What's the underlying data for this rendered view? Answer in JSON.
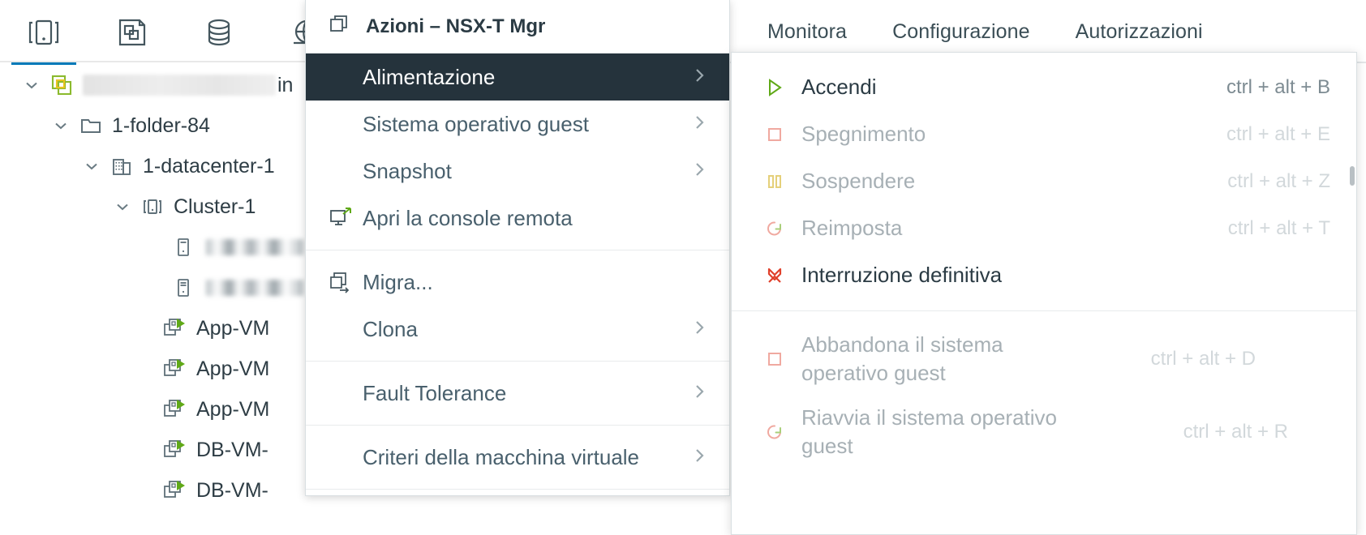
{
  "colors": {
    "accent": "#0079b8",
    "menu_highlight_bg": "#25333c",
    "text": "#2b3b44",
    "muted_text": "#7d8b92",
    "disabled_text": "#a7b0b5",
    "green": "#60a917",
    "red": "#e1604e",
    "yellow": "#d9b300",
    "border": "#e8ebec"
  },
  "icon_bar": {
    "tabs": [
      {
        "name": "hosts-and-clusters-icon",
        "label": "Host e cluster",
        "active": true
      },
      {
        "name": "vms-and-templates-icon",
        "label": "VM e modelli",
        "active": false
      },
      {
        "name": "storage-icon",
        "label": "Storage",
        "active": false
      },
      {
        "name": "networking-icon",
        "label": "Rete",
        "active": false
      }
    ]
  },
  "nav_tabs": [
    {
      "label": "Monitora"
    },
    {
      "label": "Configurazione"
    },
    {
      "label": "Autorizzazioni"
    }
  ],
  "tree": {
    "rows": [
      {
        "indent": 0,
        "twisty": "chevron-down",
        "icon": "vcenter-icon",
        "label": "",
        "redacted": true,
        "redacted_width": 250,
        "suffix": "in"
      },
      {
        "indent": 1,
        "twisty": "chevron-down",
        "icon": "folder-icon",
        "label": "1-folder-84",
        "redacted": false
      },
      {
        "indent": 2,
        "twisty": "chevron-down",
        "icon": "datacenter-icon",
        "label": "1-datacenter-1",
        "redacted": false
      },
      {
        "indent": 3,
        "twisty": "chevron-down",
        "icon": "cluster-icon",
        "label": "Cluster-1",
        "redacted": false
      },
      {
        "indent": 4,
        "twisty": "",
        "icon": "host-icon",
        "label": "",
        "redacted": true,
        "redacted_width": 130
      },
      {
        "indent": 4,
        "twisty": "",
        "icon": "host-icon",
        "label": "",
        "redacted": true,
        "redacted_width": 130
      },
      {
        "indent": 4,
        "twisty": "",
        "icon": "vm-running-icon",
        "label": "App-VM",
        "redacted": false
      },
      {
        "indent": 4,
        "twisty": "",
        "icon": "vm-running-icon",
        "label": "App-VM",
        "redacted": false
      },
      {
        "indent": 4,
        "twisty": "",
        "icon": "vm-running-icon",
        "label": "App-VM",
        "redacted": false
      },
      {
        "indent": 4,
        "twisty": "",
        "icon": "vm-running-icon",
        "label": "DB-VM-",
        "redacted": false
      },
      {
        "indent": 4,
        "twisty": "",
        "icon": "vm-running-icon",
        "label": "DB-VM-",
        "redacted": false
      }
    ]
  },
  "menu": {
    "header": {
      "title": "Azioni – NSX-T Mgr",
      "icon": "vm-actions-icon"
    },
    "items": [
      {
        "label": "Alimentazione",
        "icon": "",
        "arrow": true,
        "selected": true
      },
      {
        "label": "Sistema operativo guest",
        "icon": "",
        "arrow": true,
        "selected": false
      },
      {
        "label": "Snapshot",
        "icon": "",
        "arrow": true,
        "selected": false
      },
      {
        "label": "Apri la console remota",
        "icon": "remote-console-icon",
        "arrow": false,
        "selected": false
      },
      {
        "separator": true
      },
      {
        "label": "Migra...",
        "icon": "migrate-icon",
        "arrow": false,
        "selected": false
      },
      {
        "label": "Clona",
        "icon": "",
        "arrow": true,
        "selected": false
      },
      {
        "separator": true
      },
      {
        "label": "Fault Tolerance",
        "icon": "",
        "arrow": true,
        "selected": false
      },
      {
        "separator": true
      },
      {
        "label": "Criteri della macchina virtuale",
        "icon": "",
        "arrow": true,
        "selected": false
      }
    ]
  },
  "submenu": {
    "items": [
      {
        "label": "Accendi",
        "shortcut": "ctrl + alt + B",
        "icon": "power-on-icon",
        "disabled": false,
        "two_line": false
      },
      {
        "label": "Spegnimento",
        "shortcut": "ctrl + alt + E",
        "icon": "power-off-icon",
        "disabled": true,
        "two_line": false
      },
      {
        "label": "Sospendere",
        "shortcut": "ctrl + alt + Z",
        "icon": "suspend-icon",
        "disabled": true,
        "two_line": false
      },
      {
        "label": "Reimposta",
        "shortcut": "ctrl + alt + T",
        "icon": "reset-icon",
        "disabled": true,
        "two_line": false
      },
      {
        "label": "Interruzione definitiva",
        "shortcut": "",
        "icon": "shutdown-hard-icon",
        "disabled": false,
        "two_line": false
      },
      {
        "separator": true
      },
      {
        "label": "Abbandona il sistema operativo guest",
        "shortcut": "ctrl + alt + D",
        "icon": "guest-shutdown-icon",
        "disabled": true,
        "two_line": true
      },
      {
        "label": "Riavvia il sistema operativo guest",
        "shortcut": "ctrl + alt + R",
        "icon": "guest-restart-icon",
        "disabled": true,
        "two_line": true
      }
    ]
  }
}
